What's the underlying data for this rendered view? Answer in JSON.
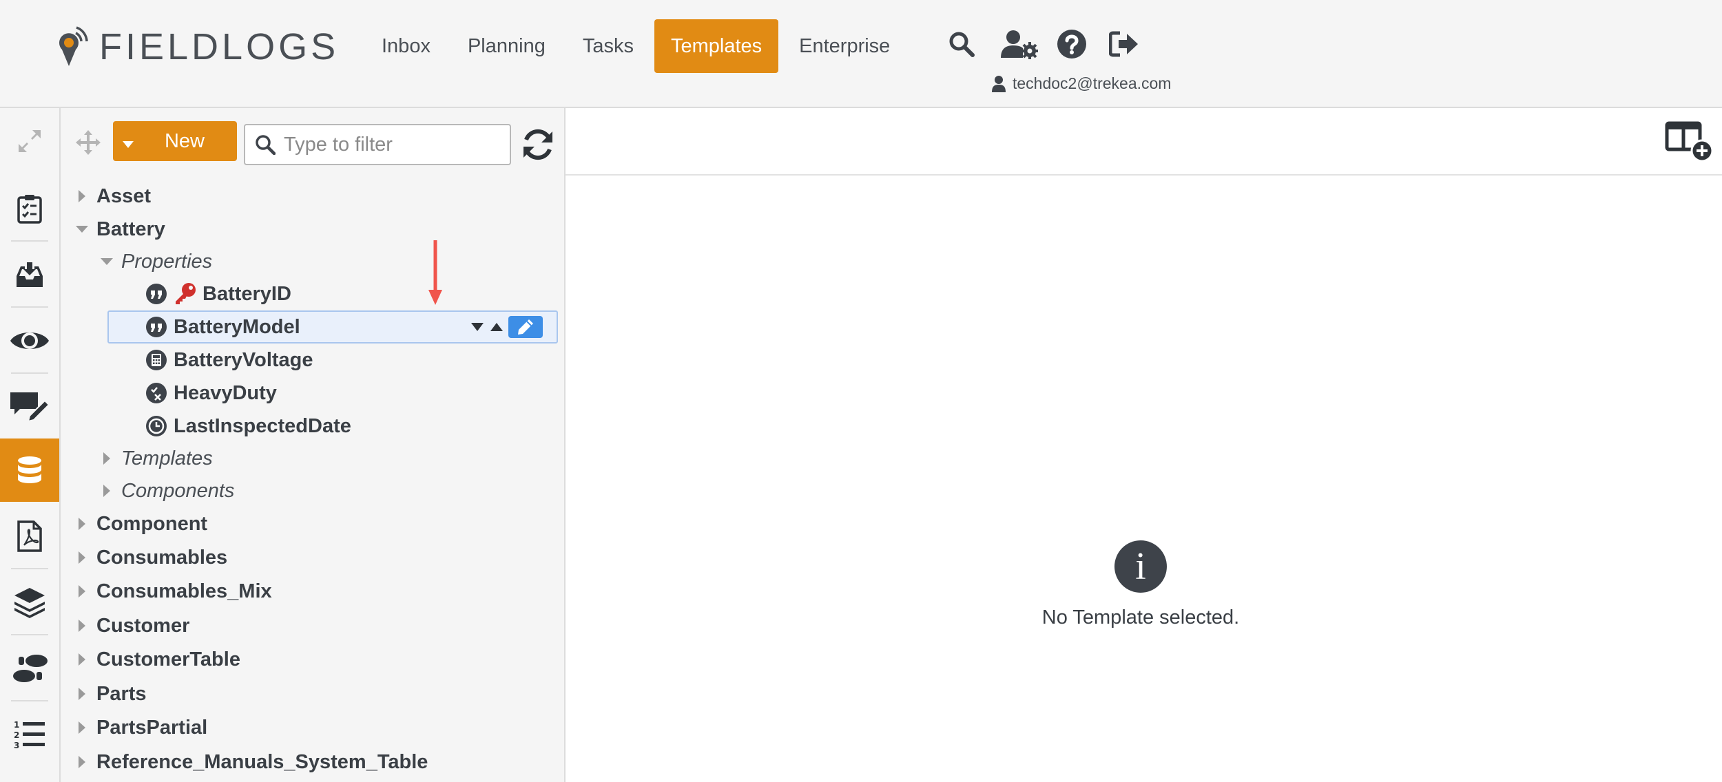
{
  "app": {
    "logo_text": "FIELDLOGS"
  },
  "nav": {
    "items": [
      {
        "label": "Inbox",
        "active": false
      },
      {
        "label": "Planning",
        "active": false
      },
      {
        "label": "Tasks",
        "active": false
      },
      {
        "label": "Templates",
        "active": true
      },
      {
        "label": "Enterprise",
        "active": false
      }
    ],
    "icons": [
      "search-icon",
      "user-settings-icon",
      "help-icon",
      "logout-icon"
    ]
  },
  "user": {
    "email": "techdoc2@trekea.com"
  },
  "rail": {
    "items": [
      "expand-icon",
      "checklist-icon",
      "inbox-download-icon",
      "eye-icon",
      "comment-edit-icon",
      "database-icon",
      "pdf-file-icon",
      "layers-icon",
      "footsteps-icon",
      "numbered-list-icon"
    ],
    "active": "database-icon"
  },
  "toolbar": {
    "new_label": "New",
    "filter_placeholder": "Type to filter"
  },
  "tree": {
    "asset": "Asset",
    "battery": "Battery",
    "properties": "Properties",
    "props": [
      {
        "label": "BatteryID",
        "icon": "quote-icon",
        "key": true
      },
      {
        "label": "BatteryModel",
        "icon": "quote-icon",
        "selected": true
      },
      {
        "label": "BatteryVoltage",
        "icon": "calculator-icon"
      },
      {
        "label": "HeavyDuty",
        "icon": "checkbox-x-icon"
      },
      {
        "label": "LastInspectedDate",
        "icon": "clock-icon"
      }
    ],
    "templates": "Templates",
    "components": "Components",
    "roots": [
      "Component",
      "Consumables",
      "Consumables_Mix",
      "Customer",
      "CustomerTable",
      "Parts",
      "PartsPartial",
      "Reference_Manuals_System_Table"
    ]
  },
  "main": {
    "empty_text": "No Template selected.",
    "info_glyph": "i"
  },
  "colors": {
    "accent": "#e18b14",
    "selected_bg": "#e9f0fb",
    "edit_blue": "#3d8ee6",
    "annotation_red": "#f0554c"
  }
}
